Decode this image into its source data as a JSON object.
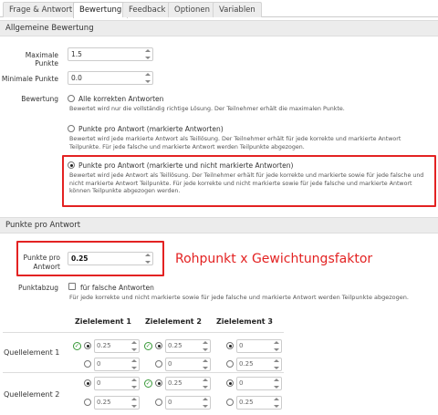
{
  "tabs": [
    {
      "label": "Frage & Antwort",
      "active": false
    },
    {
      "label": "Bewertung",
      "active": true
    },
    {
      "label": "Feedback",
      "active": false
    },
    {
      "label": "Optionen",
      "active": false
    },
    {
      "label": "Variablen",
      "active": false
    }
  ],
  "general": {
    "section_title": "Allgemeine Bewertung",
    "max_points_label": "Maximale Punkte",
    "max_points_value": "1.5",
    "min_points_label": "Minimale Punkte",
    "min_points_value": "0.0",
    "rating_label": "Bewertung",
    "options": [
      {
        "title": "Alle korrekten Antworten",
        "desc": "Bewertet wird nur die vollständig richtige Lösung. Der Teilnehmer erhält die maximalen Punkte.",
        "checked": false
      },
      {
        "title": "Punkte pro Antwort (markierte Antworten)",
        "desc": "Bewertet wird jede markierte Antwort als Teillösung. Der Teilnehmer erhält für jede korrekte und markierte Antwort Teilpunkte. Für jede falsche und markierte Antwort werden Teilpunkte abgezogen.",
        "checked": false
      },
      {
        "title": "Punkte pro Antwort (markierte und nicht markierte Antworten)",
        "desc": "Bewertet wird jede Antwort als Teillösung. Der Teilnehmer erhält für jede korrekte und markierte sowie für jede falsche und nicht markierte Antwort Teilpunkte. Für jede korrekte und nicht markierte sowie für jede falsche und markierte Antwort können Teilpunkte abgezogen werden.",
        "checked": true
      }
    ]
  },
  "per_answer": {
    "section_title": "Punkte pro Antwort",
    "points_label": "Punkte pro Antwort",
    "points_value": "0.25",
    "annotation": "Rohpunkt x Gewichtungsfaktor",
    "deduction_label": "Punktabzug",
    "deduction_checkbox_label": "für falsche Antworten",
    "deduction_desc": "Für jede korrekte und nicht markierte sowie für jede falsche und markierte Antwort werden Teilpunkte abgezogen."
  },
  "matrix": {
    "columns": [
      "Zielelement 1",
      "Zielelement 2",
      "Zielelement 3"
    ],
    "rows": [
      {
        "label": "Quellelement 1",
        "cells": [
          [
            {
              "correct": true,
              "checked": true,
              "value": "0.25"
            },
            {
              "correct": false,
              "checked": false,
              "value": "0"
            }
          ],
          [
            {
              "correct": true,
              "checked": true,
              "value": "0.25"
            },
            {
              "correct": false,
              "checked": false,
              "value": "0"
            }
          ],
          [
            {
              "correct": false,
              "checked": true,
              "value": "0"
            },
            {
              "correct": false,
              "checked": false,
              "value": "0.25"
            }
          ]
        ]
      },
      {
        "label": "Quellelement 2",
        "cells": [
          [
            {
              "correct": false,
              "checked": true,
              "value": "0"
            },
            {
              "correct": false,
              "checked": false,
              "value": "0.25"
            }
          ],
          [
            {
              "correct": true,
              "checked": true,
              "value": "0.25"
            },
            {
              "correct": false,
              "checked": false,
              "value": "0"
            }
          ],
          [
            {
              "correct": false,
              "checked": true,
              "value": "0"
            },
            {
              "correct": false,
              "checked": false,
              "value": "0.25"
            }
          ]
        ]
      }
    ]
  },
  "colors": {
    "accent_red": "#e32222",
    "correct_green": "#3a9a3a"
  }
}
